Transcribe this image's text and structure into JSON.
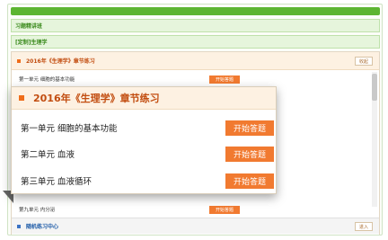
{
  "tabs": {
    "practice": "习题精讲班",
    "custom": "[定制]生理学"
  },
  "panel": {
    "title": "2016年《生理学》章节练习",
    "collapse_label": "收起",
    "rows": [
      {
        "label": "第一单元  细胞的基本功能",
        "action": "开始答题"
      },
      {
        "label": "第九单元  内分泌",
        "action": "开始答题"
      }
    ]
  },
  "bottom": {
    "title": "随机练习中心",
    "enter_label": "进入"
  },
  "zoom": {
    "title": "2016年《生理学》章节练习",
    "rows": [
      {
        "label": "第一单元  细胞的基本功能",
        "action": "开始答题"
      },
      {
        "label": "第二单元  血液",
        "action": "开始答题"
      },
      {
        "label": "第三单元  血液循环",
        "action": "开始答题"
      }
    ]
  },
  "colors": {
    "green": "#5cb531",
    "orange": "#f17a30",
    "blue": "#1f5ca8"
  }
}
